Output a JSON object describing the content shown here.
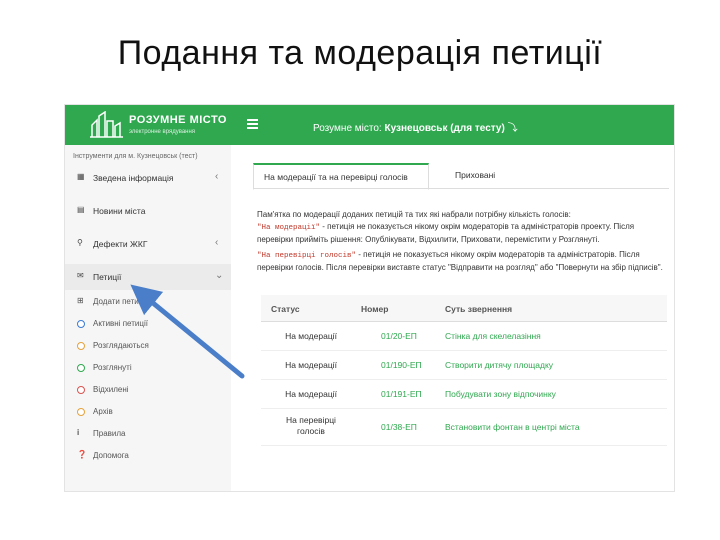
{
  "slide_title": "Подання та модерація петиції",
  "header": {
    "logo_title": "РОЗУМНЕ МІСТО",
    "logo_subtitle": "электронне врядування",
    "prefix": "Розумне місто:",
    "city": "Кузнецовськ (для тесту)",
    "brand_color": "#2fa84f"
  },
  "sidebar": {
    "caption": "Інструменти для м. Кузнецовськ (тест)",
    "items": [
      {
        "label": "Зведена інформація",
        "icon": "dashboard-icon",
        "chevron": "‹"
      },
      {
        "label": "Новини міста",
        "icon": "news-icon",
        "chevron": ""
      },
      {
        "label": "Дефекти ЖКГ",
        "icon": "search-icon",
        "chevron": "‹"
      },
      {
        "label": "Петиції",
        "icon": "chat-icon",
        "chevron": "⌄"
      }
    ],
    "subitems": [
      {
        "label": "Додати петицію",
        "kind": "plus"
      },
      {
        "label": "Активні петиції",
        "kind": "circle",
        "color": "#3a7bd5"
      },
      {
        "label": "Розглядаються",
        "kind": "circle",
        "color": "#e6a23c"
      },
      {
        "label": "Розглянуті",
        "kind": "circle",
        "color": "#2fa84f"
      },
      {
        "label": "Відхилені",
        "kind": "circle",
        "color": "#d9534f"
      },
      {
        "label": "Архів",
        "kind": "circle",
        "color": "#e6a23c"
      },
      {
        "label": "Правила",
        "kind": "info"
      },
      {
        "label": "Допомога",
        "kind": "help"
      }
    ]
  },
  "tabs": [
    {
      "label": "На модерації та на перевірці голосів"
    },
    {
      "label": "Приховані"
    }
  ],
  "memo": {
    "line1": "Пам'ятка по модерації доданих петицій та тих які набрали потрібну кількість голосів:",
    "code1": "\"На модерації\"",
    "text1": "- петиція не показується нікому окрім модераторів та адміністраторів проекту. Після перевірки прийміть рішення: Опублікувати, Відхилити, Приховати, перемістити у Розглянуті.",
    "code2": "\"На перевірці голосів\"",
    "text2": "- петиція не показується нікому окрім модераторів та адміністраторів. Після перевірки голосів. Після перевірки виставте статус \"Відправити на розгляд\" або \"Повернути на збір підписів\"."
  },
  "table": {
    "headers": {
      "status": "Статус",
      "number": "Номер",
      "subject": "Суть звернення"
    },
    "rows": [
      {
        "status": "На модерації",
        "number": "01/20-ЕП",
        "subject": "Стінка для скелелазіння"
      },
      {
        "status": "На модерації",
        "number": "01/190-ЕП",
        "subject": "Створити дитячу площадку"
      },
      {
        "status": "На модерації",
        "number": "01/191-ЕП",
        "subject": "Побудувати зону відпочинку"
      },
      {
        "status": "На перевірці голосів",
        "number": "01/38-ЕП",
        "subject": "Встановити фонтан в центрі міста"
      }
    ]
  }
}
